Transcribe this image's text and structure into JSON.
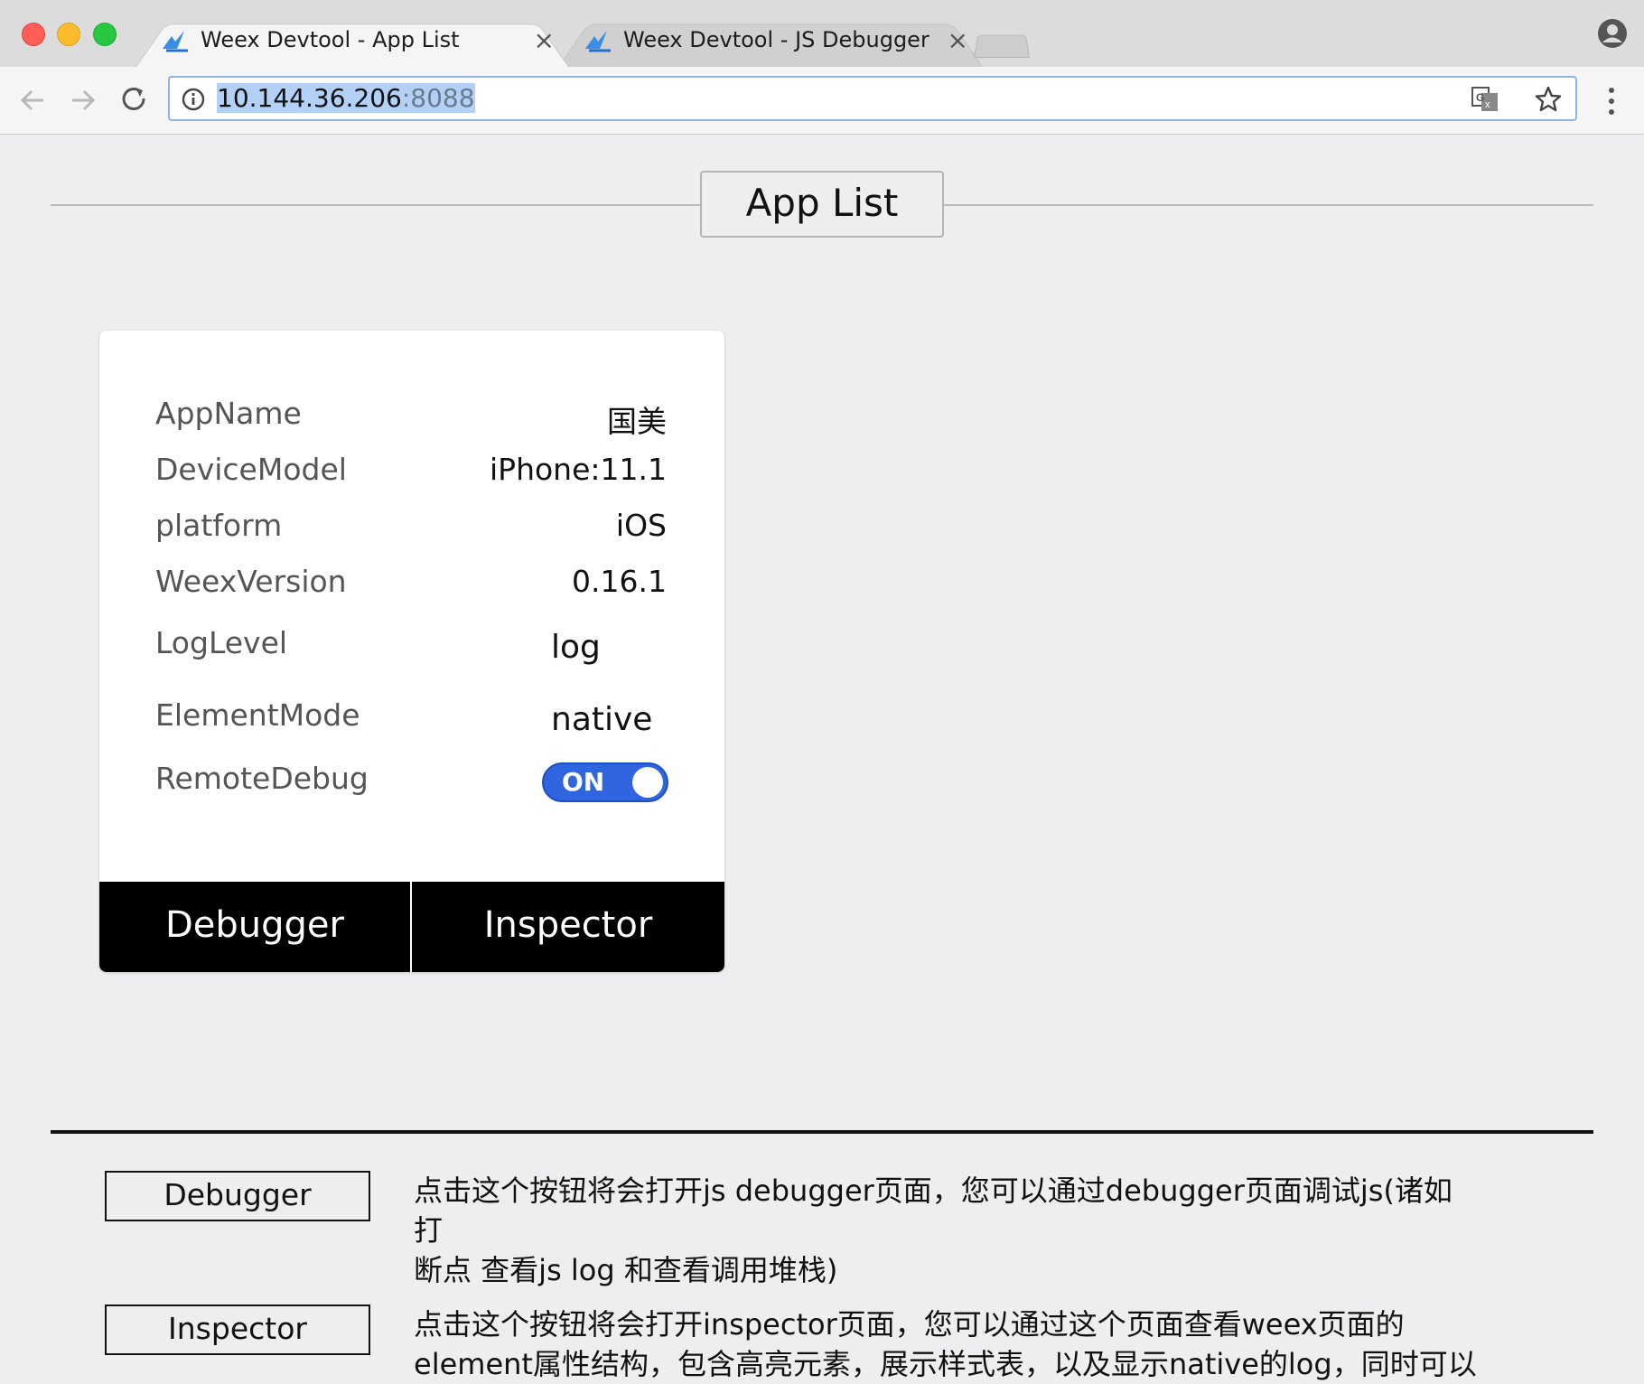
{
  "browser": {
    "tabs": [
      {
        "title": "Weex Devtool - App List",
        "active": true
      },
      {
        "title": "Weex Devtool - JS Debugger",
        "active": false
      }
    ],
    "close_glyph": "×",
    "url_host": "10.144.36.206",
    "url_port": ":8088"
  },
  "page": {
    "title": "App List"
  },
  "device_card": {
    "rows": [
      {
        "label": "AppName",
        "value": "国美"
      },
      {
        "label": "DeviceModel",
        "value": "iPhone:11.1"
      },
      {
        "label": "platform",
        "value": "iOS"
      },
      {
        "label": "WeexVersion",
        "value": "0.16.1"
      },
      {
        "label": "LogLevel",
        "value": "log"
      },
      {
        "label": "ElementMode",
        "value": "native"
      },
      {
        "label": "RemoteDebug",
        "value": "ON"
      }
    ],
    "debugger_button": "Debugger",
    "inspector_button": "Inspector"
  },
  "legend": {
    "debugger_label": "Debugger",
    "debugger_desc_line1": "点击这个按钮将会打开js debugger页面，您可以通过debugger页面调试js(诸如打",
    "debugger_desc_line2": "断点 查看js log 和查看调用堆栈)",
    "inspector_label": "Inspector",
    "inspector_desc_line1": "点击这个按钮将会打开inspector页面，您可以通过这个页面查看weex页面的",
    "inspector_desc_line2": "element属性结构，包含高亮元素，展示样式表，以及显示native的log，同时可以"
  },
  "colors": {
    "toggle_on": "#2f66e0",
    "page_bg": "#edeef0",
    "card_button_bg": "#000000"
  },
  "icons": {
    "tab_favicon": "weex-logo-icon",
    "back": "back-arrow-icon",
    "forward": "forward-arrow-icon",
    "reload": "reload-icon",
    "info": "info-icon",
    "translate": "translate-icon",
    "bookmark": "star-icon",
    "profile": "profile-icon",
    "menu": "kebab-menu-icon"
  }
}
